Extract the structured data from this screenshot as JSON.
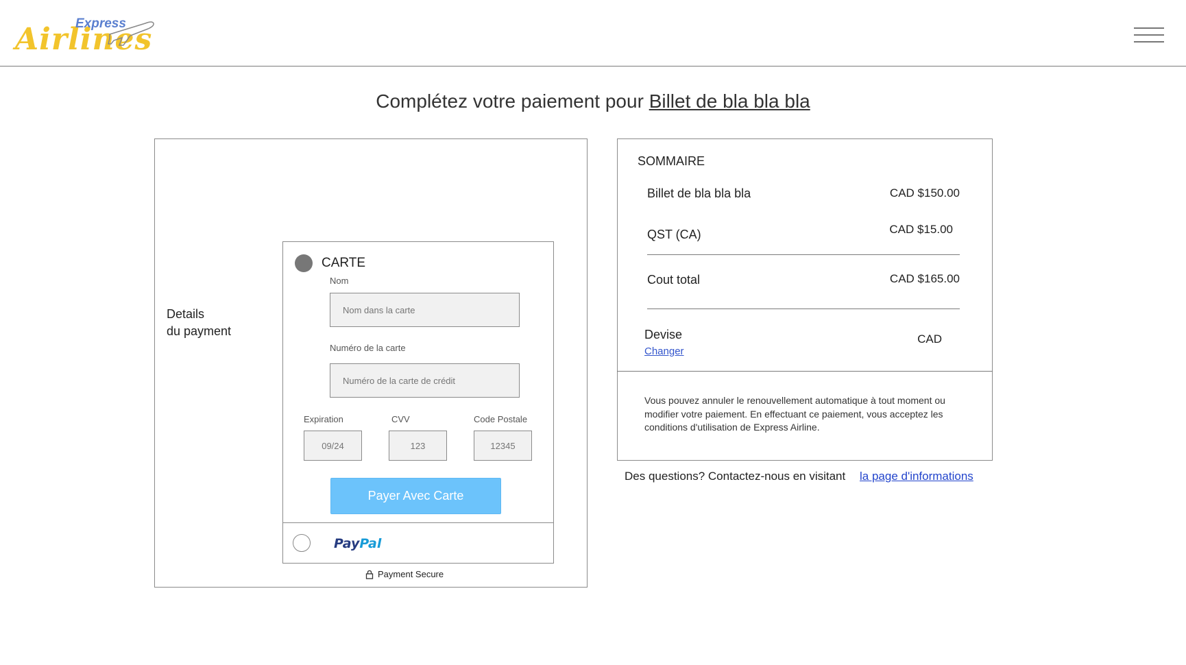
{
  "header": {
    "logo_express": "Express",
    "logo_airlines": "Airlines"
  },
  "page": {
    "title_prefix": "Complétez votre paiement pour",
    "title_ticket": "Billet de bla bla bla"
  },
  "payment": {
    "section_label_line1": "Details",
    "section_label_line2": "du payment",
    "card_option_label": "CARTE",
    "name_label": "Nom",
    "name_placeholder": "Nom dans la carte",
    "number_label": "Numéro de la carte",
    "number_placeholder": "Numéro de la carte de crédit",
    "expiration_label": "Expiration",
    "expiration_placeholder": "09/24",
    "cvv_label": "CVV",
    "cvv_placeholder": "123",
    "postal_label": "Code Postale",
    "postal_placeholder": "12345",
    "pay_button": "Payer Avec Carte",
    "paypal_pay": "Pay",
    "paypal_pal": "Pal",
    "secure_text": "Payment Secure"
  },
  "summary": {
    "title": "SOMMAIRE",
    "items": [
      {
        "label": "Billet de bla bla bla",
        "value": "CAD $150.00"
      },
      {
        "label": "QST (CA)",
        "value": "CAD $15.00"
      }
    ],
    "total_label": "Cout total",
    "total_value": "CAD $165.00",
    "currency_label": "Devise",
    "currency_value": "CAD",
    "change_link": "Changer",
    "terms": "Vous pouvez annuler le renouvellement automatique à tout moment ou modifier votre paiement. En effectuant ce paiement, vous acceptez les conditions d'utilisation de Express Airline."
  },
  "footer": {
    "questions_text": "Des questions? Contactez-nous en visitant",
    "info_link": "la page d'informations"
  },
  "colors": {
    "pay_button": "#6cc3fb",
    "link": "#2244cc",
    "logo_yellow": "#f2c42c",
    "logo_blue": "#5a7fcf"
  },
  "icons": [
    "airplane-icon",
    "hamburger-menu-icon",
    "lock-icon"
  ]
}
